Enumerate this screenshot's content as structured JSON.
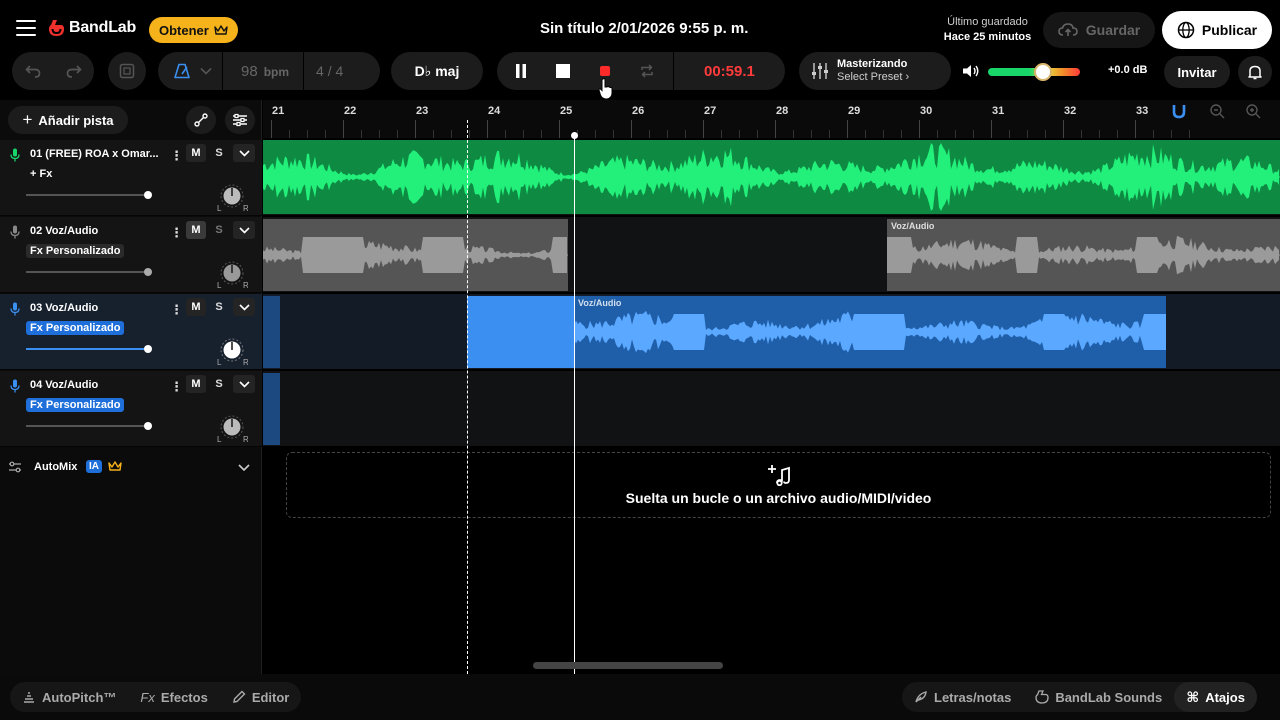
{
  "header": {
    "brand": "BandLab",
    "get_label": "Obtener",
    "project_title": "Sin título 2/01/2026 9:55 p. m.",
    "saved_line1": "Último guardado",
    "saved_line2": "Hace 25 minutos",
    "save_label": "Guardar",
    "publish_label": "Publicar"
  },
  "transport": {
    "bpm": "98",
    "bpm_unit": "bpm",
    "time_signature": "4 / 4",
    "key": "D♭ maj",
    "time": "00:59.1",
    "mastering_title": "Masterizando",
    "mastering_preset": "Select Preset",
    "master_db": "+0.0 dB",
    "master_volume": 0.6,
    "invite_label": "Invitar"
  },
  "left_panel": {
    "add_track_label": "Añadir pista",
    "automix_label": "AutoMix",
    "automix_badge": "IA"
  },
  "tracks": [
    {
      "name": "01 (FREE) ROA x Omar...",
      "fx": "+ Fx",
      "volume": 0.75,
      "muted": false,
      "color": "#19d66a"
    },
    {
      "name": "02 Voz/Audio",
      "fx": "Fx Personalizado",
      "volume": 0.75,
      "muted": true,
      "color": "#7a7a7a"
    },
    {
      "name": "03 Voz/Audio",
      "fx": "Fx Personalizado",
      "volume": 0.75,
      "muted": false,
      "color": "#3b8ff0"
    },
    {
      "name": "04 Voz/Audio",
      "fx": "Fx Personalizado",
      "volume": 0.75,
      "muted": false,
      "color": "#3b8ff0"
    }
  ],
  "ruler": {
    "bars": [
      "21",
      "22",
      "23",
      "24",
      "25",
      "26",
      "27",
      "28",
      "29",
      "30",
      "31",
      "32",
      "33"
    ]
  },
  "clips": {
    "track2_title": "Voz/Audio",
    "track3_title": "Voz/Audio"
  },
  "drop_zone": {
    "text": "Suelta un bucle o un archivo audio/MIDI/video"
  },
  "bottom": {
    "autopitch": "AutoPitch™",
    "effects": "Efectos",
    "editor": "Editor",
    "lyrics": "Letras/notas",
    "sounds": "BandLab Sounds",
    "shortcuts": "Atajos"
  },
  "colors": {
    "accent_green": "#19d66a",
    "accent_blue": "#3b8ff0",
    "record_red": "#ff3b3b",
    "brand_red": "#f0302c",
    "get_yellow": "#f5b21b"
  }
}
